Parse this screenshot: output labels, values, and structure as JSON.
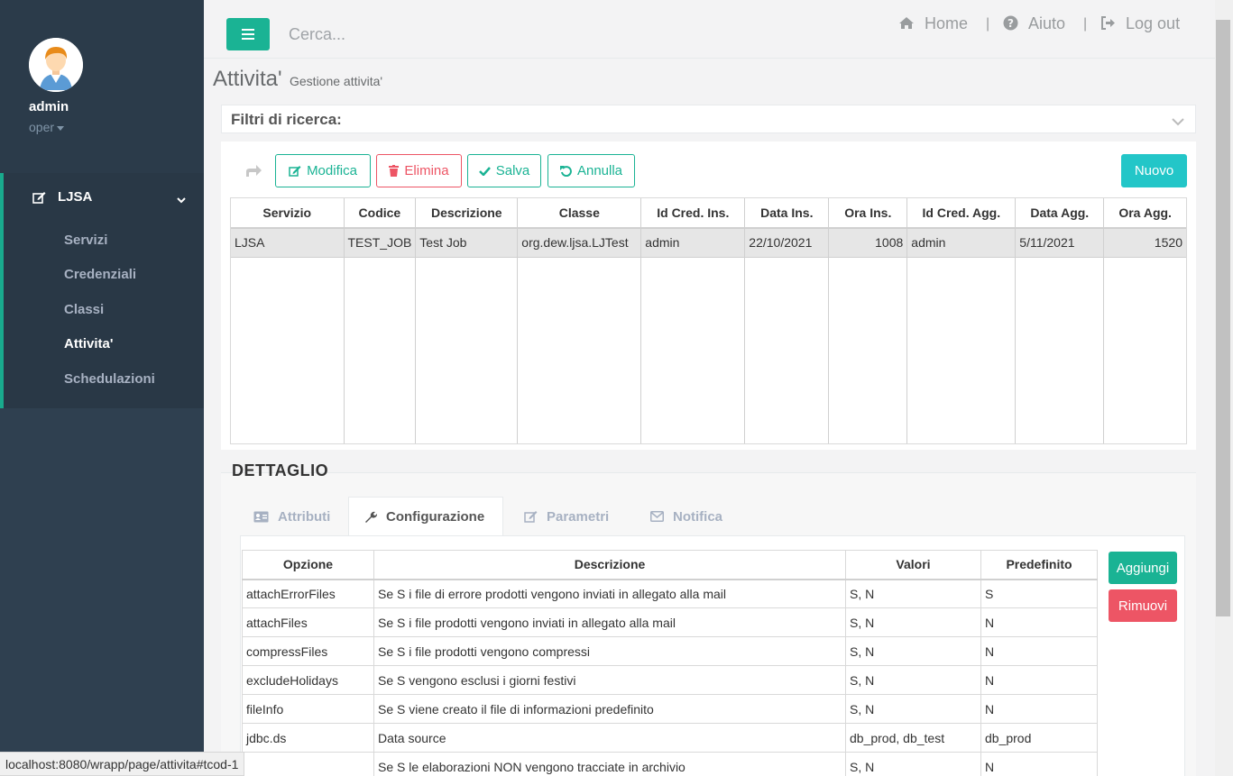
{
  "sidebar": {
    "user_name": "admin",
    "user_role": "oper",
    "group_label": "LJSA",
    "items": [
      {
        "label": "Servizi",
        "active": false
      },
      {
        "label": "Credenziali",
        "active": false
      },
      {
        "label": "Classi",
        "active": false
      },
      {
        "label": "Attivita'",
        "active": true
      },
      {
        "label": "Schedulazioni",
        "active": false
      }
    ]
  },
  "topbar": {
    "search_placeholder": "Cerca...",
    "home_label": "Home",
    "help_label": "Aiuto",
    "logout_label": "Log out",
    "separator": "|"
  },
  "page": {
    "title": "Attivita'",
    "subtitle": "Gestione attivita'"
  },
  "filters": {
    "title": "Filtri di ricerca:"
  },
  "toolbar": {
    "edit_label": "Modifica",
    "delete_label": "Elimina",
    "save_label": "Salva",
    "cancel_label": "Annulla",
    "new_label": "Nuovo"
  },
  "grid": {
    "columns": [
      "Servizio",
      "Codice",
      "Descrizione",
      "Classe",
      "Id Cred. Ins.",
      "Data Ins.",
      "Ora Ins.",
      "Id Cred. Agg.",
      "Data Agg.",
      "Ora Agg."
    ],
    "rows": [
      [
        "LJSA",
        "TEST_JOB",
        "Test Job",
        "org.dew.ljsa.LJTest",
        "admin",
        "22/10/2021",
        "1008",
        "admin",
        "5/11/2021",
        "1520"
      ]
    ]
  },
  "detail": {
    "title": "DETTAGLIO",
    "tabs": [
      {
        "label": "Attributi",
        "icon": "id-card-icon",
        "active": false
      },
      {
        "label": "Configurazione",
        "icon": "wrench-icon",
        "active": true
      },
      {
        "label": "Parametri",
        "icon": "edit-icon",
        "active": false
      },
      {
        "label": "Notifica",
        "icon": "envelope-icon",
        "active": false
      }
    ],
    "config_columns": [
      "Opzione",
      "Descrizione",
      "Valori",
      "Predefinito"
    ],
    "config_rows": [
      [
        "attachErrorFiles",
        "Se S i file di errore prodotti vengono inviati in allegato alla mail",
        "S, N",
        "S"
      ],
      [
        "attachFiles",
        "Se S i file prodotti vengono inviati in allegato alla mail",
        "S, N",
        "N"
      ],
      [
        "compressFiles",
        "Se S i file prodotti vengono compressi",
        "S, N",
        "N"
      ],
      [
        "excludeHolidays",
        "Se S vengono esclusi i giorni festivi",
        "S, N",
        "N"
      ],
      [
        "fileInfo",
        "Se S viene creato il file di informazioni predefinito",
        "S, N",
        "N"
      ],
      [
        "jdbc.ds",
        "Data source",
        "db_prod, db_test",
        "db_prod"
      ],
      [
        "",
        "Se S le elaborazioni NON vengono tracciate in archivio",
        "S, N",
        "N"
      ]
    ],
    "add_label": "Aggiungi",
    "remove_label": "Rimuovi"
  },
  "statusbar": {
    "url": "localhost:8080/wrapp/page/attivita#tcod-1"
  },
  "colors": {
    "sidebar": "#2f4050",
    "primary": "#1ab394",
    "danger": "#ed5565",
    "info": "#23c6c8"
  }
}
